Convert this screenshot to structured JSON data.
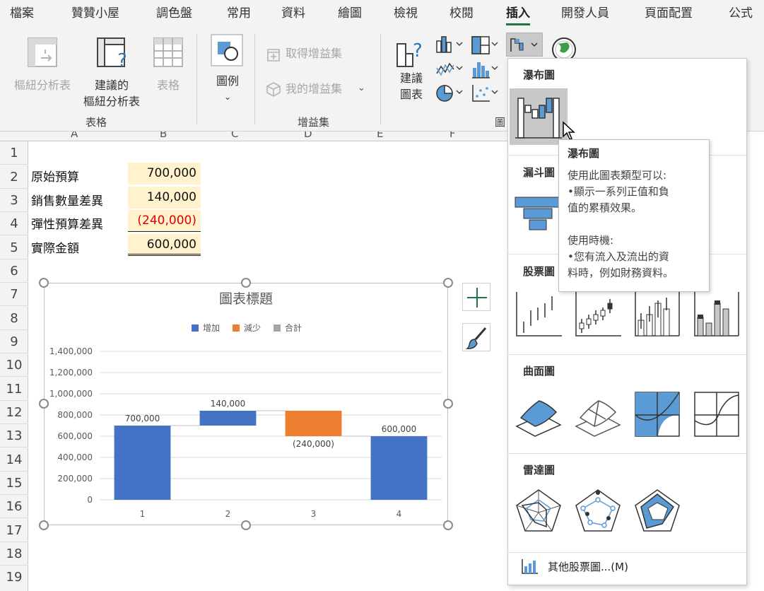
{
  "tabs": [
    "檔案",
    "贊贊小屋",
    "調色盤",
    "常用",
    "資料",
    "繪圖",
    "檢視",
    "校閱",
    "插入",
    "開發人員",
    "頁面配置",
    "公式"
  ],
  "active_tab": "插入",
  "ribbon": {
    "table_group": {
      "label": "表格",
      "pivot": "樞紐分析表",
      "recommended_pivot_line1": "建議的",
      "recommended_pivot_line2": "樞紐分析表",
      "table": "表格"
    },
    "legend_group": {
      "label": "圖例"
    },
    "addins_group": {
      "label": "增益集",
      "get_addins": "取得增益集",
      "my_addins": "我的增益集"
    },
    "charts_group": {
      "label": "圖",
      "recommended_line1": "建議",
      "recommended_line2": "圖表"
    }
  },
  "columns": [
    "A",
    "B",
    "C",
    "D",
    "E",
    "F"
  ],
  "rows": [
    "1",
    "2",
    "3",
    "4",
    "5",
    "6",
    "7",
    "8",
    "9",
    "10",
    "11",
    "12",
    "13",
    "14",
    "15",
    "16",
    "17",
    "18",
    "19"
  ],
  "cells": [
    {
      "label": "原始預算",
      "value": "700,000"
    },
    {
      "label": "銷售數量差異",
      "value": "140,000"
    },
    {
      "label": "彈性預算差異",
      "value": "(240,000)"
    },
    {
      "label": "實際金額",
      "value": "600,000"
    }
  ],
  "chart_data": {
    "type": "bar",
    "subtype": "waterfall",
    "title": "圖表標題",
    "legend": [
      "增加",
      "減少",
      "合計"
    ],
    "legend_placement": "top",
    "categories": [
      "1",
      "2",
      "3",
      "4"
    ],
    "values": [
      700000,
      140000,
      -240000,
      600000
    ],
    "bar_kinds": [
      "total-start",
      "increase",
      "decrease",
      "total"
    ],
    "data_labels": [
      "700,000",
      "140,000",
      "(240,000)",
      "600,000"
    ],
    "ylim": [
      0,
      1400000
    ],
    "yticks": [
      "0",
      "200,000",
      "400,000",
      "600,000",
      "800,000",
      "1,000,000",
      "1,200,000",
      "1,400,000"
    ],
    "grid": true,
    "colors": {
      "increase": "#4472c4",
      "decrease": "#ed7d31",
      "total": "#a5a5a5"
    }
  },
  "dropdown": {
    "sections": [
      "瀑布圖",
      "漏斗圖",
      "股票圖",
      "曲面圖",
      "雷達圖"
    ],
    "more": "其他股票圖...(M)"
  },
  "tooltip": {
    "title": "瀑布圖",
    "lines": [
      "使用此圖表類型可以:",
      "•顯示一系列正值和負",
      "值的累積效果。",
      "",
      "使用時機:",
      "•您有流入及流出的資",
      "料時，例如財務資料。"
    ]
  }
}
